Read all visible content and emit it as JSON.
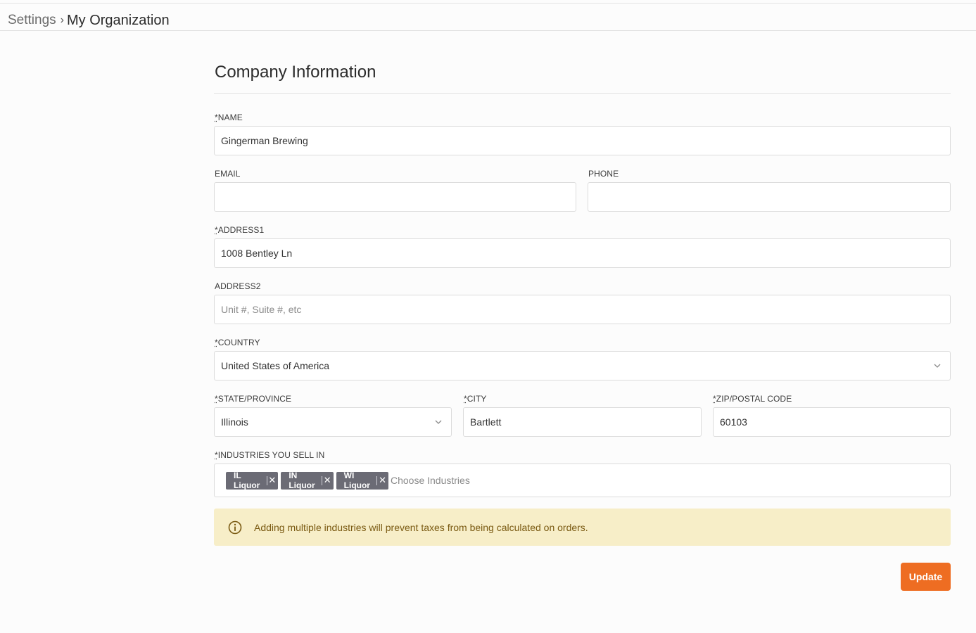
{
  "breadcrumb": {
    "root": "Settings",
    "separator": "›",
    "current": "My Organization"
  },
  "section": {
    "title": "Company Information"
  },
  "form": {
    "name": {
      "required_mark": "*",
      "label": "NAME",
      "value": "Gingerman Brewing",
      "placeholder": ""
    },
    "email": {
      "label": "EMAIL",
      "value": "",
      "placeholder": ""
    },
    "phone": {
      "label": "PHONE",
      "value": "",
      "placeholder": ""
    },
    "address1": {
      "required_mark": "*",
      "label": "ADDRESS1",
      "value": "1008 Bentley Ln",
      "placeholder": ""
    },
    "address2": {
      "label": "ADDRESS2",
      "value": "",
      "placeholder": "Unit #, Suite #, etc"
    },
    "country": {
      "required_mark": "*",
      "label": "COUNTRY",
      "value": "United States of America",
      "icon": "chevron-down-icon"
    },
    "state": {
      "required_mark": "*",
      "label": "STATE/PROVINCE",
      "value": "Illinois",
      "icon": "chevron-down-icon"
    },
    "city": {
      "required_mark": "*",
      "label": "CITY",
      "value": "Bartlett",
      "placeholder": ""
    },
    "zip": {
      "required_mark": "*",
      "label": "ZIP/POSTAL CODE",
      "value": "60103",
      "placeholder": ""
    },
    "industries": {
      "required_mark": "*",
      "label": "INDUSTRIES YOU SELL IN",
      "tags": [
        {
          "label": "IL Liquor",
          "remove": "✕"
        },
        {
          "label": "IN Liquor",
          "remove": "✕"
        },
        {
          "label": "WI Liquor",
          "remove": "✕"
        }
      ],
      "placeholder": "Choose Industries"
    }
  },
  "alert": {
    "icon": "info-icon",
    "message": "Adding multiple industries will prevent taxes from being calculated on orders.",
    "color": "#7a5a12",
    "background": "#f7eec8"
  },
  "actions": {
    "update_label": "Update",
    "accent": "#ee6d22"
  }
}
